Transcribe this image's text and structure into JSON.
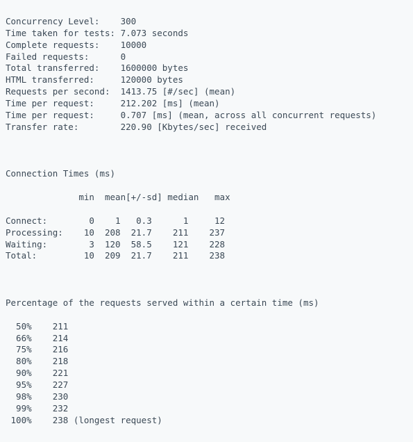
{
  "summary": [
    {
      "label": "Concurrency Level:",
      "value": "300"
    },
    {
      "label": "Time taken for tests:",
      "value": "7.073 seconds"
    },
    {
      "label": "Complete requests:",
      "value": "10000"
    },
    {
      "label": "Failed requests:",
      "value": "0"
    },
    {
      "label": "Total transferred:",
      "value": "1600000 bytes"
    },
    {
      "label": "HTML transferred:",
      "value": "120000 bytes"
    },
    {
      "label": "Requests per second:",
      "value": "1413.75 [#/sec] (mean)"
    },
    {
      "label": "Time per request:",
      "value": "212.202 [ms] (mean)"
    },
    {
      "label": "Time per request:",
      "value": "0.707 [ms] (mean, across all concurrent requests)"
    },
    {
      "label": "Transfer rate:",
      "value": "220.90 [Kbytes/sec] received"
    }
  ],
  "conn_heading": "Connection Times (ms)",
  "conn_header_cols": [
    "min",
    "mean",
    "[+/-sd]",
    "median",
    "max"
  ],
  "conn_rows": [
    {
      "label": "Connect:",
      "min": "0",
      "mean": "1",
      "sd": "0.3",
      "median": "1",
      "max": "12"
    },
    {
      "label": "Processing:",
      "min": "10",
      "mean": "208",
      "sd": "21.7",
      "median": "211",
      "max": "237"
    },
    {
      "label": "Waiting:",
      "min": "3",
      "mean": "120",
      "sd": "58.5",
      "median": "121",
      "max": "228"
    },
    {
      "label": "Total:",
      "min": "10",
      "mean": "209",
      "sd": "21.7",
      "median": "211",
      "max": "238"
    }
  ],
  "pct_heading": "Percentage of the requests served within a certain time (ms)",
  "pct_rows": [
    {
      "pct": "50%",
      "value": "211",
      "note": ""
    },
    {
      "pct": "66%",
      "value": "214",
      "note": ""
    },
    {
      "pct": "75%",
      "value": "216",
      "note": ""
    },
    {
      "pct": "80%",
      "value": "218",
      "note": ""
    },
    {
      "pct": "90%",
      "value": "221",
      "note": ""
    },
    {
      "pct": "95%",
      "value": "227",
      "note": ""
    },
    {
      "pct": "98%",
      "value": "230",
      "note": ""
    },
    {
      "pct": "99%",
      "value": "232",
      "note": ""
    },
    {
      "pct": "100%",
      "value": "238",
      "note": " (longest request)"
    }
  ]
}
